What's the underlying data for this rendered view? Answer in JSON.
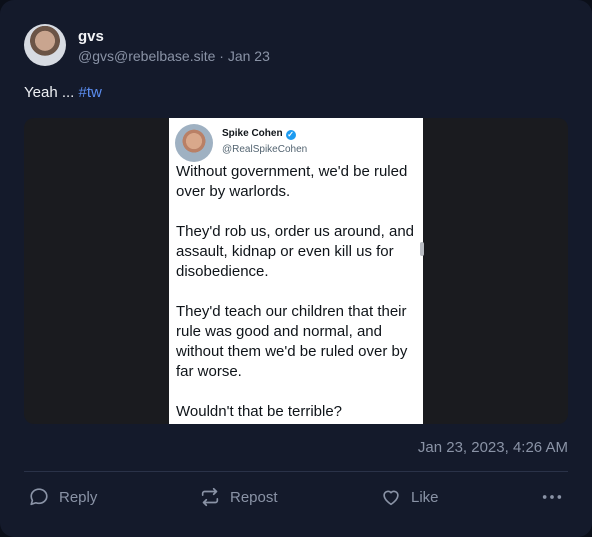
{
  "post": {
    "display_name": "gvs",
    "handle": "@gvs@rebelbase.site",
    "separator": " · ",
    "date": "Jan 23",
    "text": "Yeah ... ",
    "hashtag": "#tw",
    "timestamp": "Jan 23, 2023, 4:26 AM"
  },
  "embedded_tweet": {
    "name": "Spike Cohen",
    "handle": "@RealSpikeCohen",
    "paragraphs": [
      "Without government, we'd be ruled over by warlords.",
      "They'd rob us, order us around, and assault, kidnap or even kill us for disobedience.",
      "They'd teach our children that their rule was good and normal, and without them we'd be ruled over by far worse.",
      "Wouldn't that be terrible?"
    ]
  },
  "actions": {
    "reply": "Reply",
    "repost": "Repost",
    "like": "Like"
  },
  "colors": {
    "card": "#141a2b",
    "muted": "#8a93a6",
    "link": "#5b8def"
  }
}
